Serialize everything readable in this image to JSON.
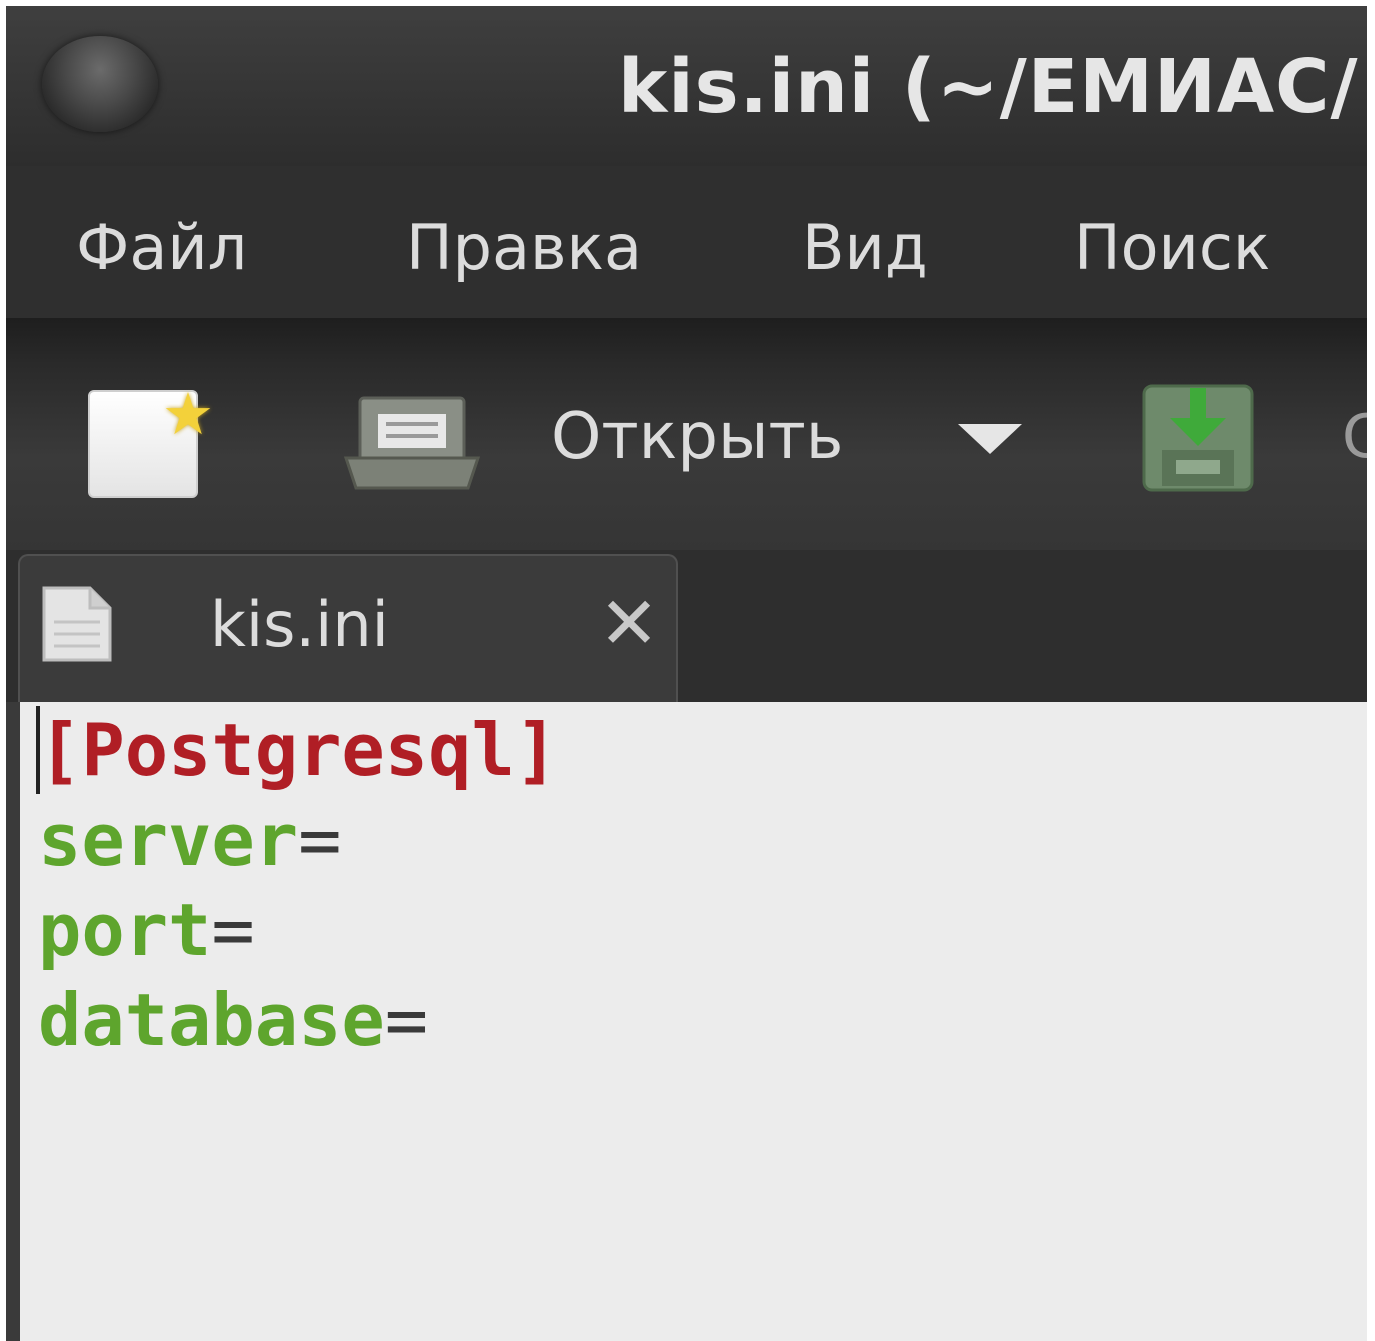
{
  "window": {
    "title": "kis.ini (~/ЕМИАС/"
  },
  "menubar": {
    "items": [
      "Файл",
      "Правка",
      "Вид",
      "Поиск"
    ]
  },
  "toolbar": {
    "new_icon": "new-document-icon",
    "open_icon": "open-folder-icon",
    "open_label": "Открыть",
    "dropdown_icon": "dropdown-arrow-icon",
    "save_icon": "save-icon",
    "partial_label": "С"
  },
  "tabs": [
    {
      "label": "kis.ini",
      "icon": "document-icon",
      "close_icon": "close-icon",
      "close_glyph": "✕"
    }
  ],
  "editor": {
    "lines": [
      {
        "section": "[Postgresql]"
      },
      {
        "key": "server",
        "op": "="
      },
      {
        "key": "port",
        "op": "="
      },
      {
        "key": "database",
        "op": "="
      }
    ]
  },
  "colors": {
    "section": "#b01e25",
    "key": "#5ea52d",
    "editor_bg": "#ececec",
    "chrome_bg": "#2f2f2f"
  }
}
